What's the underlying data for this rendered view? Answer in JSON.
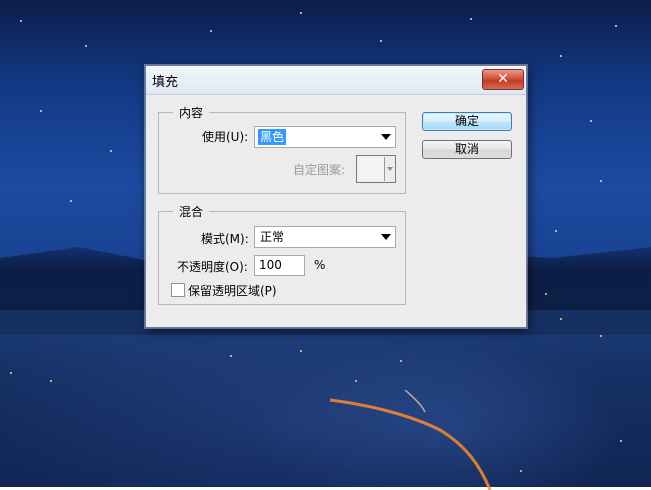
{
  "dialog": {
    "title": "填充",
    "close_label": "✕",
    "content_group": {
      "legend": "内容",
      "use_label": "使用(U):",
      "use_value": "黑色",
      "custom_pattern_label": "自定图案:"
    },
    "blend_group": {
      "legend": "混合",
      "mode_label": "模式(M):",
      "mode_value": "正常",
      "opacity_label": "不透明度(O):",
      "opacity_value": "100",
      "opacity_unit": "%",
      "preserve_transparency_label": "保留透明区域(P)",
      "preserve_transparency_checked": false
    },
    "buttons": {
      "ok_label": "确定",
      "cancel_label": "取消"
    }
  },
  "colors": {
    "selection": "#3399ff",
    "close_button": "#c94a34",
    "default_button_border": "#3c7fb1"
  }
}
